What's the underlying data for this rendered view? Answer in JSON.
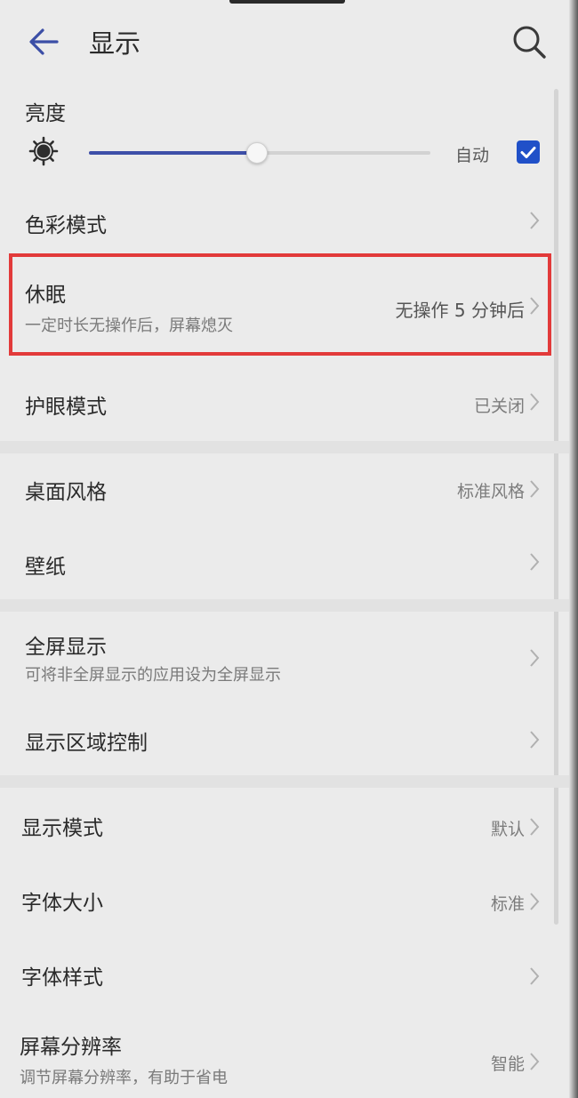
{
  "header": {
    "title": "显示",
    "back_icon": "arrow-left-icon",
    "search_icon": "search-icon"
  },
  "brightness": {
    "label": "亮度",
    "level": 0.49,
    "auto_label": "自动",
    "auto_checked": true,
    "accent": "#3d4fa8",
    "checkbox_color": "#2050c8"
  },
  "color_mode": {
    "label": "色彩模式"
  },
  "sleep": {
    "label": "休眠",
    "subtitle": "一定时长无操作后，屏幕熄灭",
    "value": "无操作 5 分钟后",
    "highlight_color": "#e23a3a"
  },
  "eye_comfort": {
    "label": "护眼模式",
    "value": "已关闭"
  },
  "desktop_style": {
    "label": "桌面风格",
    "value": "标准风格"
  },
  "wallpaper": {
    "label": "壁纸"
  },
  "full_screen": {
    "label": "全屏显示",
    "subtitle": "可将非全屏显示的应用设为全屏显示"
  },
  "display_area": {
    "label": "显示区域控制"
  },
  "display_mode": {
    "label": "显示模式",
    "value": "默认"
  },
  "font_size": {
    "label": "字体大小",
    "value": "标准"
  },
  "font_style": {
    "label": "字体样式"
  },
  "resolution": {
    "label": "屏幕分辨率",
    "subtitle": "调节屏幕分辨率，有助于省电",
    "value": "智能"
  }
}
